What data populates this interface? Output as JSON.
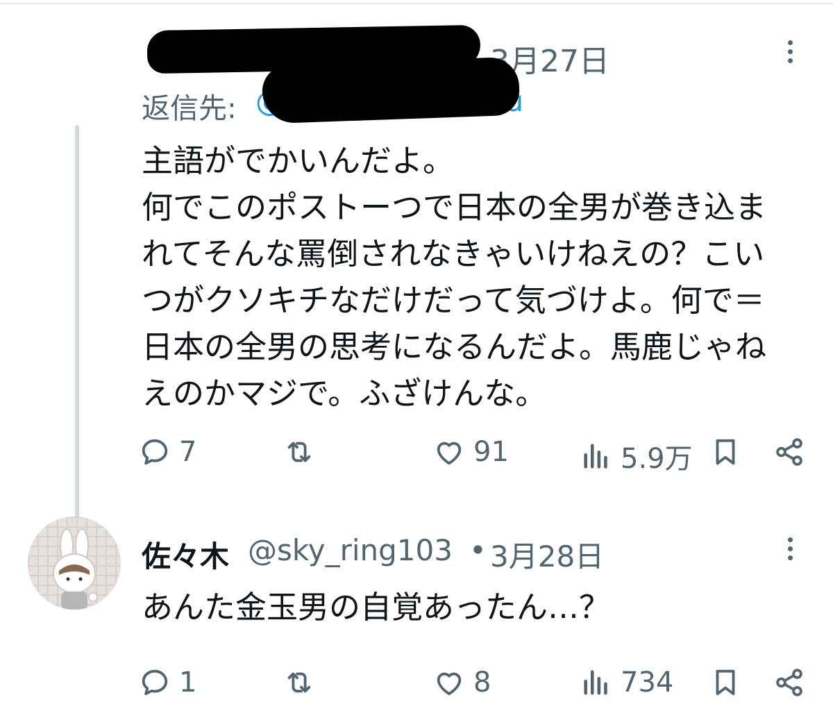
{
  "tweet1": {
    "date": "3月27日",
    "reply_to_label": "返信先:",
    "reply_to_at": "@",
    "reply_to_tail": "u",
    "text": "主語がでかいんだよ。\n何でこのポストーつで日本の全男が巻き込ま\nれてそんな罵倒されなきゃいけねえの？こい\nつがクソキチなだけだって気づけよ。何で＝\n日本の全男の思考になるんだよ。馬鹿じゃね\nえのかマジで。ふざけんな。",
    "stats": {
      "replies": "7",
      "reposts": "",
      "likes": "91",
      "views": "5.9万"
    }
  },
  "tweet2": {
    "name": "佐々木",
    "handle": "@sky_ring103",
    "separator": "•",
    "date": "3月28日",
    "text": "あんた金玉男の自覚あったん…？",
    "stats": {
      "replies": "1",
      "reposts": "",
      "likes": "8",
      "views": "734"
    }
  },
  "colors": {
    "text": "#0f1419",
    "secondary": "#536471",
    "link": "#1d9bf0",
    "thread_line": "#cfd9de"
  },
  "icons": [
    "more-icon",
    "reply-icon",
    "repost-icon",
    "like-icon",
    "views-icon",
    "bookmark-icon",
    "share-icon"
  ]
}
